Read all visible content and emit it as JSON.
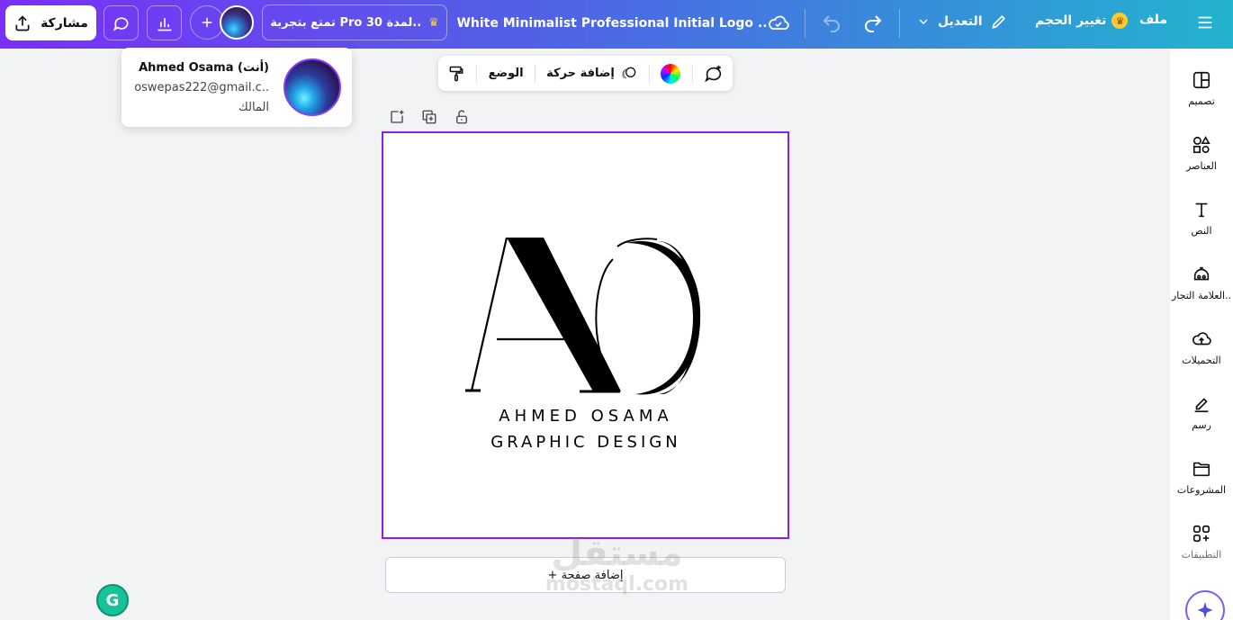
{
  "topbar": {
    "share_label": "مشاركة",
    "pro_label": "تمتع بتجربة Pro لمدة 30..",
    "title": "White Minimalist Professional Initial Logo ..",
    "edit_label": "التعديل",
    "resize_label": "تغيير الحجم",
    "file_label": "ملف"
  },
  "float_toolbar": {
    "position_label": "الوضع",
    "animate_label": "إضافة حركة"
  },
  "user_card": {
    "name": "Ahmed Osama (أنت)",
    "email": "oswepas222@gmail.c..",
    "role": "المالك"
  },
  "logo": {
    "monogram": "AO",
    "line1": "AHMED OSAMA",
    "line2": "GRAPHIC DESIGN"
  },
  "add_page_label": "+ إضافة صفحة",
  "sidebar": {
    "items": [
      {
        "label": "تصميم",
        "icon": "design-icon"
      },
      {
        "label": "العناصر",
        "icon": "elements-icon"
      },
      {
        "label": "النص",
        "icon": "text-icon"
      },
      {
        "label": "العلامة التجار..",
        "icon": "brand-icon"
      },
      {
        "label": "التحميلات",
        "icon": "upload-cloud-icon"
      },
      {
        "label": "رسم",
        "icon": "draw-icon"
      },
      {
        "label": "المشروعات",
        "icon": "folder-icon"
      },
      {
        "label": "التطبيقات",
        "icon": "apps-icon"
      }
    ]
  },
  "watermark": {
    "arabic": "مستقل",
    "latin": "mostaql.com"
  },
  "colors": {
    "accent": "#8b1ff0",
    "gradient_start": "#7b2ff7",
    "gradient_end": "#22b3cf"
  }
}
